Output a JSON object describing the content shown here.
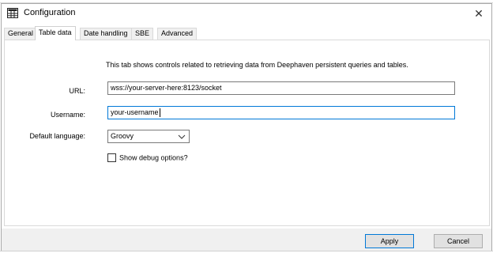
{
  "window": {
    "title": "Configuration",
    "close_glyph": "✕"
  },
  "tabs": [
    {
      "label": "General",
      "active": false
    },
    {
      "label": "Table data",
      "active": true
    },
    {
      "label": "Date handling",
      "active": false
    },
    {
      "label": "SBE",
      "active": false
    },
    {
      "label": "Advanced",
      "active": false
    }
  ],
  "panel": {
    "description": "This tab shows controls related to retrieving data from Deephaven persistent queries and tables.",
    "url_label": "URL:",
    "url_value": "wss://your-server-here:8123/socket",
    "username_label": "Username:",
    "username_value": "your-username",
    "language_label": "Default language:",
    "language_value": "Groovy",
    "debug_label": "Show debug options?",
    "debug_checked": false
  },
  "footer": {
    "apply_label": "Apply",
    "cancel_label": "Cancel"
  },
  "colors": {
    "focus_border": "#0078d7",
    "footer_bg": "#f0f0f0"
  }
}
